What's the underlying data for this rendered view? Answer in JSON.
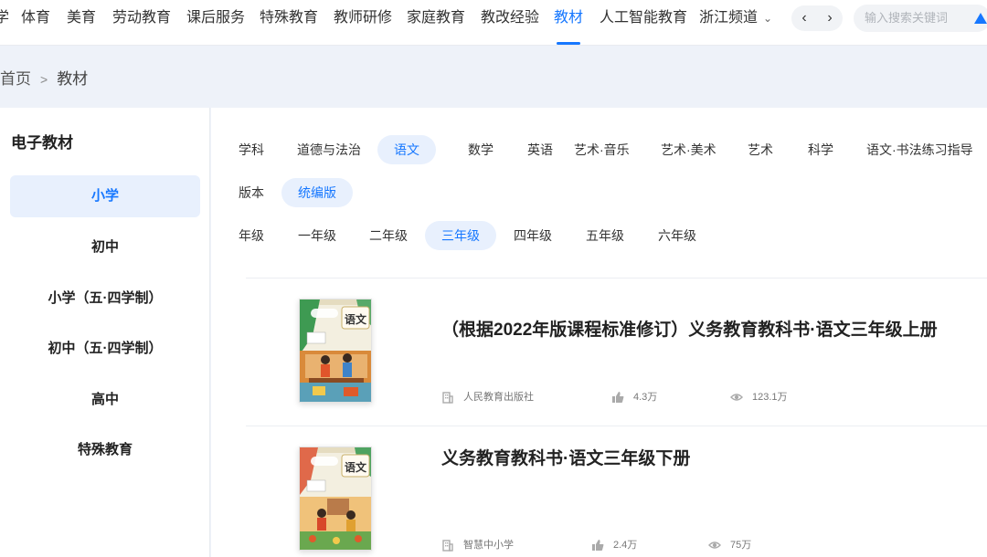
{
  "nav": {
    "items": [
      {
        "label": "学",
        "active": false
      },
      {
        "label": "体育",
        "active": false
      },
      {
        "label": "美育",
        "active": false
      },
      {
        "label": "劳动教育",
        "active": false
      },
      {
        "label": "课后服务",
        "active": false
      },
      {
        "label": "特殊教育",
        "active": false
      },
      {
        "label": "教师研修",
        "active": false
      },
      {
        "label": "家庭教育",
        "active": false
      },
      {
        "label": "教改经验",
        "active": false
      },
      {
        "label": "教材",
        "active": true
      },
      {
        "label": "人工智能教育",
        "active": false
      },
      {
        "label": "浙江频道",
        "active": false
      }
    ],
    "prev_icon": "‹",
    "next_icon": "›",
    "search_placeholder": "输入搜索关键词",
    "accent_color": "#1677ff"
  },
  "breadcrumb": {
    "home": "首页",
    "separator": ">",
    "current": "教材"
  },
  "sidebar": {
    "title": "电子教材",
    "items": [
      {
        "label": "小学",
        "active": true
      },
      {
        "label": "初中",
        "active": false
      },
      {
        "label": "小学（五·四学制）",
        "active": false
      },
      {
        "label": "初中（五·四学制）",
        "active": false
      },
      {
        "label": "高中",
        "active": false
      },
      {
        "label": "特殊教育",
        "active": false
      }
    ]
  },
  "filters": {
    "subject": {
      "label": "学科",
      "options": [
        "道德与法治",
        "语文",
        "数学",
        "英语",
        "艺术·音乐",
        "艺术·美术",
        "艺术",
        "科学",
        "语文·书法练习指导"
      ],
      "selected": "语文"
    },
    "edition": {
      "label": "版本",
      "options": [
        "统编版"
      ],
      "selected": "统编版"
    },
    "grade": {
      "label": "年级",
      "options": [
        "一年级",
        "二年级",
        "三年级",
        "四年级",
        "五年级",
        "六年级"
      ],
      "selected": "三年级"
    }
  },
  "books": [
    {
      "title": "（根据2022年版课程标准修订）义务教育教科书·语文三年级上册",
      "publisher": "人民教育出版社",
      "likes": "4.3万",
      "views": "123.1万",
      "cover_text": "语文"
    },
    {
      "title": "义务教育教科书·语文三年级下册",
      "publisher": "智慧中小学",
      "likes": "2.4万",
      "views": "75万",
      "cover_text": "语文"
    }
  ]
}
